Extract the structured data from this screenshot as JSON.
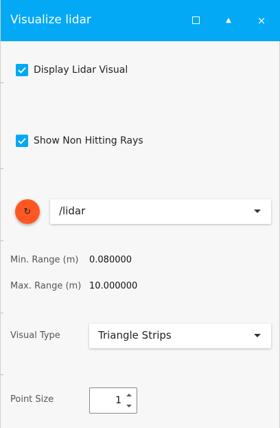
{
  "window": {
    "title": "Visualize lidar",
    "maximize_icon": "maximize-icon",
    "minimize_icon": "minimize-icon",
    "close_icon": "close-icon",
    "close_glyph": "×",
    "minimize_glyph": "▲"
  },
  "display_lidar": {
    "label": "Display Lidar Visual",
    "checked": true
  },
  "show_non_hitting": {
    "label": "Show Non Hitting Rays",
    "checked": true
  },
  "refresh": {
    "icon": "refresh-icon",
    "glyph": "↻",
    "color": "#ff5722"
  },
  "topic": {
    "value": "/lidar"
  },
  "min_range": {
    "label": "Min. Range (m)",
    "value": "0.080000"
  },
  "max_range": {
    "label": "Max. Range (m)",
    "value": "10.000000"
  },
  "visual_type": {
    "label": "Visual Type",
    "value": "Triangle Strips"
  },
  "point_size": {
    "label": "Point Size",
    "value": "1"
  },
  "colors": {
    "accent": "#03a9f4",
    "refresh": "#ff5722"
  }
}
